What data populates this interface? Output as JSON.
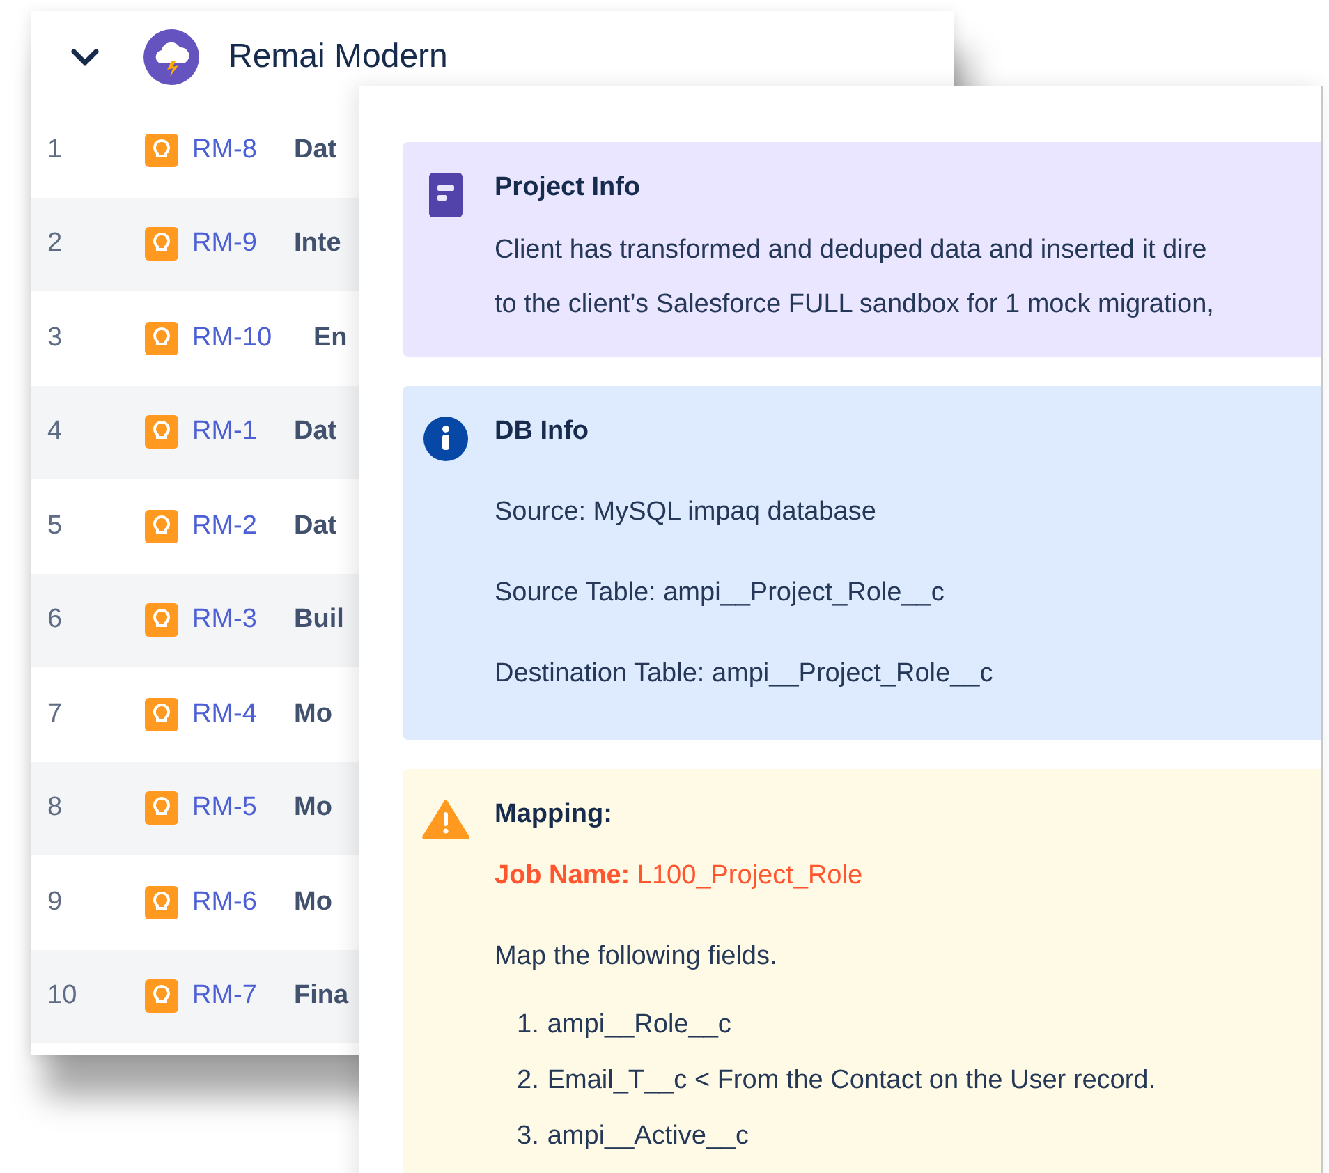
{
  "project": {
    "name": "Remai Modern",
    "expanded": true
  },
  "issues": [
    {
      "rank": "1",
      "key": "RM-8",
      "title": "Dat"
    },
    {
      "rank": "2",
      "key": "RM-9",
      "title": "Inte"
    },
    {
      "rank": "3",
      "key": "RM-10",
      "title": "En"
    },
    {
      "rank": "4",
      "key": "RM-1",
      "title": "Dat"
    },
    {
      "rank": "5",
      "key": "RM-2",
      "title": "Dat"
    },
    {
      "rank": "6",
      "key": "RM-3",
      "title": "Buil"
    },
    {
      "rank": "7",
      "key": "RM-4",
      "title": "Mo"
    },
    {
      "rank": "8",
      "key": "RM-5",
      "title": "Mo"
    },
    {
      "rank": "9",
      "key": "RM-6",
      "title": "Mo"
    },
    {
      "rank": "10",
      "key": "RM-7",
      "title": "Fina"
    }
  ],
  "panels": [
    {
      "kind": "note",
      "title": "Project Info",
      "lines": [
        "Client has transformed and deduped data and inserted it dire",
        "to the client’s Salesforce FULL sandbox for 1 mock migration,"
      ]
    },
    {
      "kind": "info",
      "title": "DB Info",
      "lines": [
        "Source: MySQL impaq database",
        "Source Table: ampi__Project_Role__c",
        "Destination Table: ampi__Project_Role__c"
      ]
    },
    {
      "kind": "warning",
      "title": "Mapping:",
      "job_label": "Job Name:",
      "job_value": "L100_Project_Role",
      "intro": "Map the following fields.",
      "fields": [
        {
          "number": "1.",
          "text": "ampi__Role__c"
        },
        {
          "number": "2.",
          "text": "Email_T__c < From the Contact on the User record."
        },
        {
          "number": "3.",
          "text": "ampi__Active__c"
        }
      ]
    }
  ]
}
